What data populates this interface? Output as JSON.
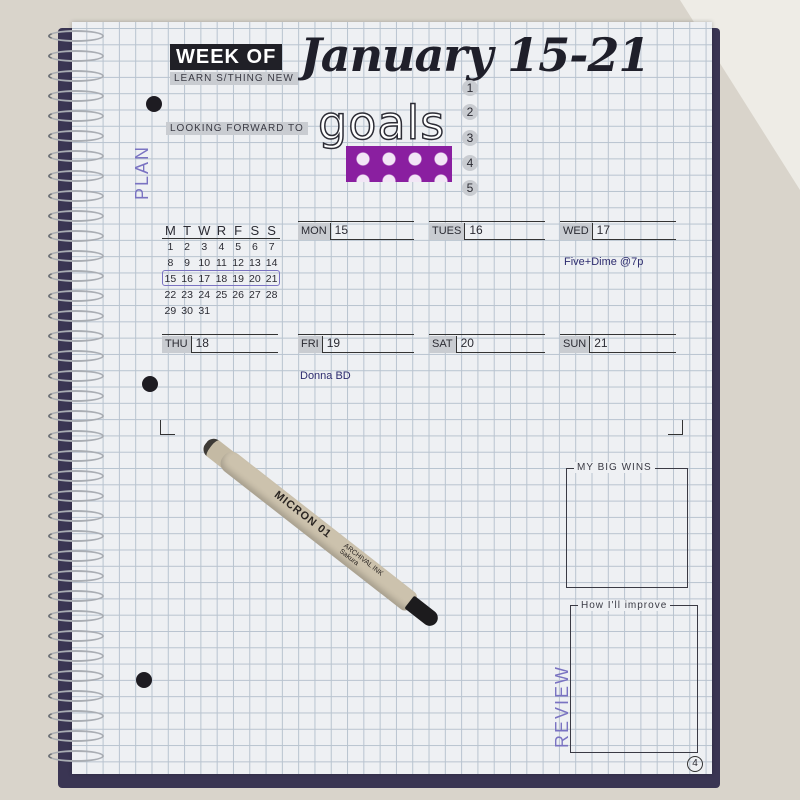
{
  "header": {
    "week_label": "WEEK OF",
    "week_date": "January 15-21",
    "learn_tag": "LEARN S/THING NEW",
    "forward_tag": "LOOKING FORWARD TO"
  },
  "goals": {
    "title": "goals",
    "numbers": [
      "1",
      "2",
      "3",
      "4",
      "5"
    ]
  },
  "sections": {
    "plan_label": "PLAN",
    "review_label": "REVIEW"
  },
  "mini_calendar": {
    "headers": [
      "M",
      "T",
      "W",
      "R",
      "F",
      "S",
      "S"
    ],
    "weeks": [
      [
        "1",
        "2",
        "3",
        "4",
        "5",
        "6",
        "7"
      ],
      [
        "8",
        "9",
        "10",
        "11",
        "12",
        "13",
        "14"
      ],
      [
        "15",
        "16",
        "17",
        "18",
        "19",
        "20",
        "21"
      ],
      [
        "22",
        "23",
        "24",
        "25",
        "26",
        "27",
        "28"
      ],
      [
        "29",
        "30",
        "31",
        "",
        "",
        "",
        ""
      ]
    ],
    "highlight_color": "#7a73c2"
  },
  "days": [
    {
      "name": "MON",
      "date": "15"
    },
    {
      "name": "TUES",
      "date": "16"
    },
    {
      "name": "WED",
      "date": "17",
      "event": "Five+Dime @7p"
    },
    {
      "name": "THU",
      "date": "18"
    },
    {
      "name": "FRI",
      "date": "19",
      "event": "Donna BD"
    },
    {
      "name": "SAT",
      "date": "20"
    },
    {
      "name": "SUN",
      "date": "21"
    }
  ],
  "review": {
    "wins_title": "MY BIG WINS",
    "improve_title": "How I'll improve"
  },
  "page_number": "4",
  "pen": {
    "brand": "MICRON 01",
    "sub_1": "ARCHIVAL INK",
    "sub_2": "Sakura"
  },
  "colors": {
    "washi_tape": "#8a1fa0",
    "accent_ink": "#7a73c2",
    "label_fill": "#c9ccd1"
  }
}
